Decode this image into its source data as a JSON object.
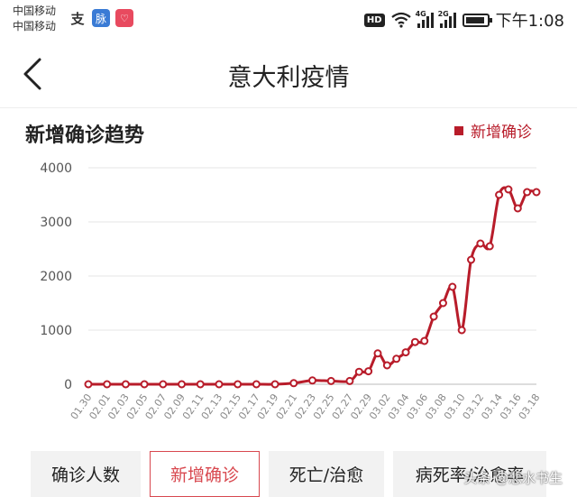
{
  "status_bar": {
    "carrier_1": "中国移动",
    "carrier_2": "中国移动",
    "app_icon_1": "支",
    "app_icon_2": "脉",
    "app_icon_3": "♡",
    "hd": "HD",
    "signal_1_tag": "4G",
    "signal_2_tag": "2G",
    "time": "下午1:08"
  },
  "nav": {
    "title": "意大利疫情"
  },
  "card": {
    "title": "新增确诊趋势",
    "legend": "新增确诊"
  },
  "colors": {
    "series": "#b81c2a",
    "accent": "#d8484f",
    "grid": "#e6e6e6",
    "axis_text": "#555555"
  },
  "chart_data": {
    "type": "line",
    "ylim": [
      0,
      4000
    ],
    "yticks": [
      0,
      1000,
      2000,
      3000,
      4000
    ],
    "xtick_labels": [
      "01.30",
      "02.01",
      "02.03",
      "02.05",
      "02.07",
      "02.09",
      "02.11",
      "02.13",
      "02.15",
      "02.17",
      "02.19",
      "02.21",
      "02.23",
      "02.25",
      "02.27",
      "02.29",
      "03.02",
      "03.04",
      "03.06",
      "03.08",
      "03.10",
      "03.12",
      "03.14",
      "03.16",
      "03.18"
    ],
    "series": [
      {
        "name": "新增确诊",
        "x": [
          "01.30",
          "02.01",
          "02.03",
          "02.05",
          "02.07",
          "02.09",
          "02.11",
          "02.13",
          "02.15",
          "02.17",
          "02.19",
          "02.21",
          "02.23",
          "02.25",
          "02.27",
          "02.28",
          "02.29",
          "03.01",
          "03.02",
          "03.03",
          "03.04",
          "03.05",
          "03.06",
          "03.07",
          "03.08",
          "03.09",
          "03.10",
          "03.11",
          "03.12",
          "03.13",
          "03.14",
          "03.15",
          "03.16",
          "03.17",
          "03.18"
        ],
        "values": [
          0,
          0,
          0,
          0,
          0,
          0,
          0,
          0,
          0,
          0,
          0,
          20,
          70,
          60,
          60,
          230,
          240,
          570,
          350,
          470,
          590,
          780,
          800,
          1250,
          1500,
          1800,
          1000,
          2300,
          2600,
          2550,
          3500,
          3600,
          3250,
          3550,
          3550
        ]
      }
    ]
  },
  "tabs": [
    {
      "label": "确诊人数"
    },
    {
      "label": "新增确诊"
    },
    {
      "label": "死亡/治愈"
    },
    {
      "label": "病死率/治愈率"
    }
  ],
  "watermark": "头条 @悲水书生"
}
